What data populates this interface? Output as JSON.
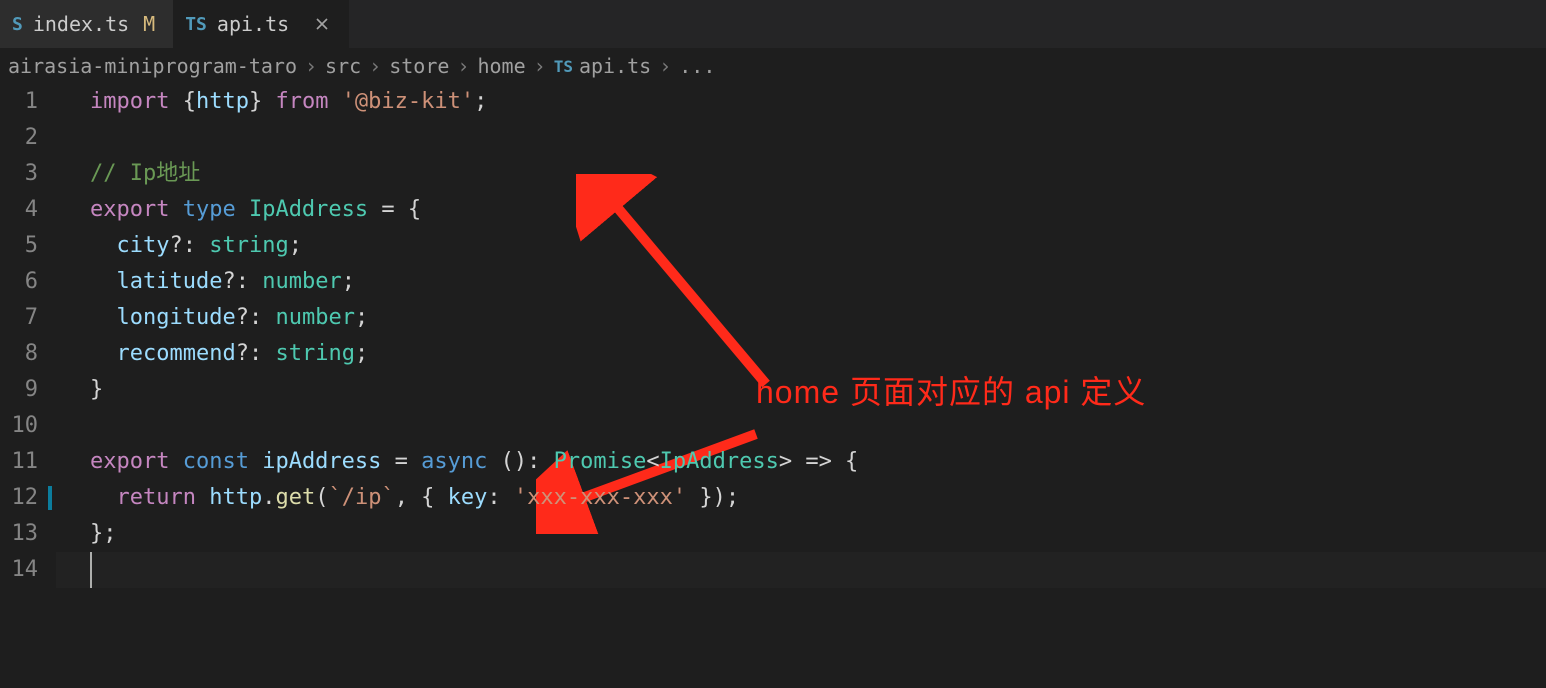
{
  "tabs": [
    {
      "icon_prefix": "S",
      "label": "index.ts",
      "modified_marker": "M",
      "active": false
    },
    {
      "icon_prefix": "TS",
      "label": "api.ts",
      "modified_marker": "",
      "active": true
    }
  ],
  "breadcrumb": {
    "segments": [
      "airasia-miniprogram-taro",
      "src",
      "store",
      "home"
    ],
    "file_icon": "TS",
    "file": "api.ts",
    "trailing": "..."
  },
  "code": {
    "lines": [
      [
        {
          "t": "import ",
          "c": "kw"
        },
        {
          "t": "{",
          "c": "pun"
        },
        {
          "t": "http",
          "c": "id"
        },
        {
          "t": "} ",
          "c": "pun"
        },
        {
          "t": "from ",
          "c": "kw"
        },
        {
          "t": "'@biz-kit'",
          "c": "str"
        },
        {
          "t": ";",
          "c": "pun"
        }
      ],
      [],
      [
        {
          "t": "// Ip地址",
          "c": "cmt"
        }
      ],
      [
        {
          "t": "export ",
          "c": "kw"
        },
        {
          "t": "type ",
          "c": "kw2"
        },
        {
          "t": "IpAddress",
          "c": "typ"
        },
        {
          "t": " = {",
          "c": "pun"
        }
      ],
      [
        {
          "t": "  ",
          "c": "pun"
        },
        {
          "t": "city",
          "c": "id"
        },
        {
          "t": "?: ",
          "c": "pun"
        },
        {
          "t": "string",
          "c": "typ"
        },
        {
          "t": ";",
          "c": "pun"
        }
      ],
      [
        {
          "t": "  ",
          "c": "pun"
        },
        {
          "t": "latitude",
          "c": "id"
        },
        {
          "t": "?: ",
          "c": "pun"
        },
        {
          "t": "number",
          "c": "typ"
        },
        {
          "t": ";",
          "c": "pun"
        }
      ],
      [
        {
          "t": "  ",
          "c": "pun"
        },
        {
          "t": "longitude",
          "c": "id"
        },
        {
          "t": "?: ",
          "c": "pun"
        },
        {
          "t": "number",
          "c": "typ"
        },
        {
          "t": ";",
          "c": "pun"
        }
      ],
      [
        {
          "t": "  ",
          "c": "pun"
        },
        {
          "t": "recommend",
          "c": "id"
        },
        {
          "t": "?: ",
          "c": "pun"
        },
        {
          "t": "string",
          "c": "typ"
        },
        {
          "t": ";",
          "c": "pun"
        }
      ],
      [
        {
          "t": "}",
          "c": "pun"
        }
      ],
      [],
      [
        {
          "t": "export ",
          "c": "kw"
        },
        {
          "t": "const ",
          "c": "kw2"
        },
        {
          "t": "ipAddress",
          "c": "id"
        },
        {
          "t": " = ",
          "c": "pun"
        },
        {
          "t": "async ",
          "c": "kw2"
        },
        {
          "t": "(): ",
          "c": "pun"
        },
        {
          "t": "Promise",
          "c": "typ"
        },
        {
          "t": "<",
          "c": "pun"
        },
        {
          "t": "IpAddress",
          "c": "typ"
        },
        {
          "t": "> => {",
          "c": "pun"
        }
      ],
      [
        {
          "t": "  ",
          "c": "pun"
        },
        {
          "t": "return ",
          "c": "kw"
        },
        {
          "t": "http",
          "c": "id"
        },
        {
          "t": ".",
          "c": "pun"
        },
        {
          "t": "get",
          "c": "fn"
        },
        {
          "t": "(",
          "c": "pun"
        },
        {
          "t": "`/ip`",
          "c": "str"
        },
        {
          "t": ", { ",
          "c": "pun"
        },
        {
          "t": "key",
          "c": "id"
        },
        {
          "t": ": ",
          "c": "pun"
        },
        {
          "t": "'xxx-xxx-xxx'",
          "c": "str"
        },
        {
          "t": " });",
          "c": "pun"
        }
      ],
      [
        {
          "t": "};",
          "c": "pun"
        }
      ],
      []
    ],
    "modified_line_index": 11,
    "cursor_line_index": 13
  },
  "annotation": {
    "text": "home 页面对应的 api 定义",
    "color": "#ff2a1a"
  }
}
